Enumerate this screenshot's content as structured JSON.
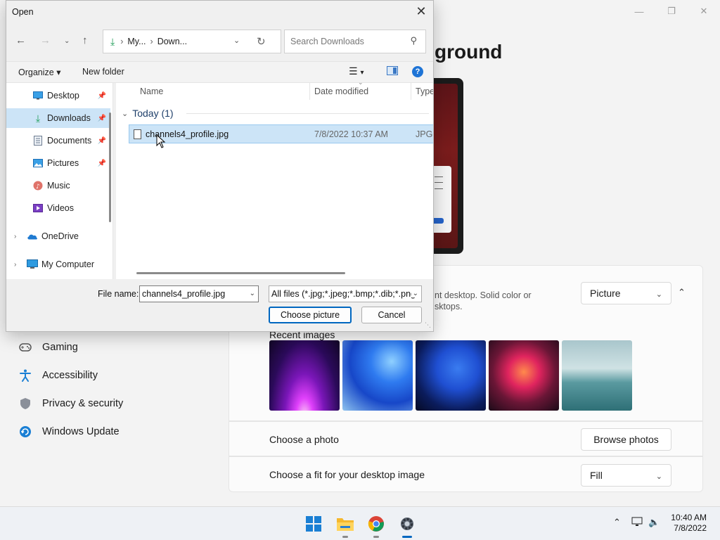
{
  "settings": {
    "page_title": "ground",
    "background_section": {
      "description": "nt desktop. Solid color or\nsktops.",
      "personalize_value": "Picture"
    },
    "recent_images_label": "Recent images",
    "choose_photo_label": "Choose a photo",
    "browse_button": "Browse photos",
    "fit_label": "Choose a fit for your desktop image",
    "fit_value": "Fill",
    "nav": [
      {
        "label": "Gaming",
        "icon": "gaming-icon"
      },
      {
        "label": "Accessibility",
        "icon": "accessibility-icon"
      },
      {
        "label": "Privacy & security",
        "icon": "shield-icon"
      },
      {
        "label": "Windows Update",
        "icon": "update-icon"
      }
    ]
  },
  "dialog": {
    "title": "Open",
    "breadcrumb": [
      "My...",
      "Down..."
    ],
    "search_placeholder": "Search Downloads",
    "toolbar": {
      "organize": "Organize",
      "new_folder": "New folder"
    },
    "tree": [
      {
        "label": "Desktop",
        "icon": "desktop-icon",
        "pinned": true
      },
      {
        "label": "Downloads",
        "icon": "download-icon",
        "pinned": true,
        "selected": true
      },
      {
        "label": "Documents",
        "icon": "documents-icon",
        "pinned": true
      },
      {
        "label": "Pictures",
        "icon": "pictures-icon",
        "pinned": true
      },
      {
        "label": "Music",
        "icon": "music-icon"
      },
      {
        "label": "Videos",
        "icon": "videos-icon"
      },
      {
        "label": "OneDrive",
        "icon": "onedrive-icon"
      },
      {
        "label": "My Computer",
        "icon": "computer-icon"
      }
    ],
    "columns": {
      "name": "Name",
      "date": "Date modified",
      "type": "Type"
    },
    "group": "Today (1)",
    "files": [
      {
        "name": "channels4_profile.jpg",
        "date": "7/8/2022 10:37 AM",
        "type": "JPG F"
      }
    ],
    "file_name_label": "File name:",
    "file_name_value": "channels4_profile.jpg",
    "file_type_value": "All files (*.jpg;*.jpeg;*.bmp;*.dib;*.png",
    "choose_button": "Choose picture",
    "cancel_button": "Cancel"
  },
  "taskbar": {
    "time": "10:40 AM",
    "date": "7/8/2022",
    "apps": [
      "start-icon",
      "file-explorer-icon",
      "chrome-icon",
      "settings-icon"
    ]
  },
  "colors": {
    "accent": "#0067c0",
    "selection": "#cce4f7"
  }
}
